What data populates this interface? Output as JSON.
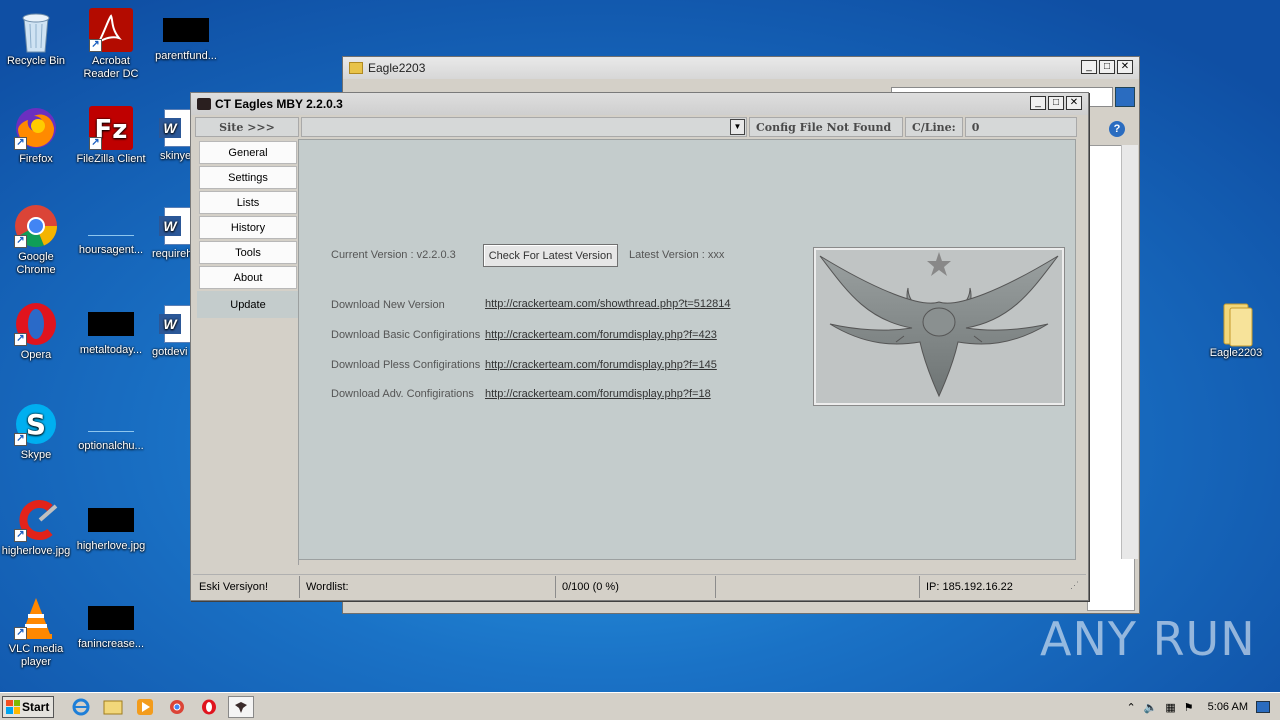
{
  "desktop": {
    "icons": [
      {
        "name": "recycle-bin",
        "label": "Recycle Bin"
      },
      {
        "name": "acrobat",
        "label": "Acrobat Reader DC"
      },
      {
        "name": "parentfund",
        "label": "parentfund..."
      },
      {
        "name": "firefox",
        "label": "Firefox"
      },
      {
        "name": "filezilla",
        "label": "FileZilla Client"
      },
      {
        "name": "skinye",
        "label": "skinye"
      },
      {
        "name": "chrome",
        "label": "Google Chrome"
      },
      {
        "name": "hoursagent",
        "label": "hoursagent..."
      },
      {
        "name": "requireh",
        "label": "requireh"
      },
      {
        "name": "opera",
        "label": "Opera"
      },
      {
        "name": "metaltoday",
        "label": "metaltoday..."
      },
      {
        "name": "gotdevi",
        "label": "gotdevi"
      },
      {
        "name": "skype",
        "label": "Skype"
      },
      {
        "name": "optionalchu",
        "label": "optionalchu..."
      },
      {
        "name": "ccleaner",
        "label": "CCleaner"
      },
      {
        "name": "higherlove",
        "label": "higherlove.jpg"
      },
      {
        "name": "vlc",
        "label": "VLC media player"
      },
      {
        "name": "fanincrease",
        "label": "fanincrease..."
      },
      {
        "name": "eagle2203-folder",
        "label": "Eagle2203"
      }
    ]
  },
  "explorer": {
    "title": "Eagle2203"
  },
  "app": {
    "title": "CT Eagles MBY 2.2.0.3",
    "site_label": "Site >>>",
    "site_value": "",
    "config_status": "Config File Not Found",
    "cline_label": "C/Line:",
    "cline_value": "0",
    "nav": [
      "General",
      "Settings",
      "Lists",
      "History",
      "Tools",
      "About",
      "Update"
    ],
    "update": {
      "current_version": "Current Version : v2.2.0.3",
      "check_button": "Check For Latest Version",
      "latest_version": "Latest Version :  xxx",
      "rows": [
        {
          "label": "Download New Version",
          "url": "http://crackerteam.com/showthread.php?t=512814"
        },
        {
          "label": "Download Basic Configirations",
          "url": "http://crackerteam.com/forumdisplay.php?f=423"
        },
        {
          "label": "Download Pless Configirations",
          "url": "http://crackerteam.com/forumdisplay.php?f=145"
        },
        {
          "label": "Download Adv.  Configirations",
          "url": "http://crackerteam.com/forumdisplay.php?f=18"
        }
      ]
    },
    "status": {
      "version_state": "Eski Versiyon!",
      "wordlist": "Wordlist:",
      "progress": "0/100 (0 %)",
      "empty": "",
      "ip": "IP:  185.192.16.22"
    }
  },
  "taskbar": {
    "start": "Start",
    "clock": "5:06 AM"
  },
  "watermark": "ANY RUN"
}
